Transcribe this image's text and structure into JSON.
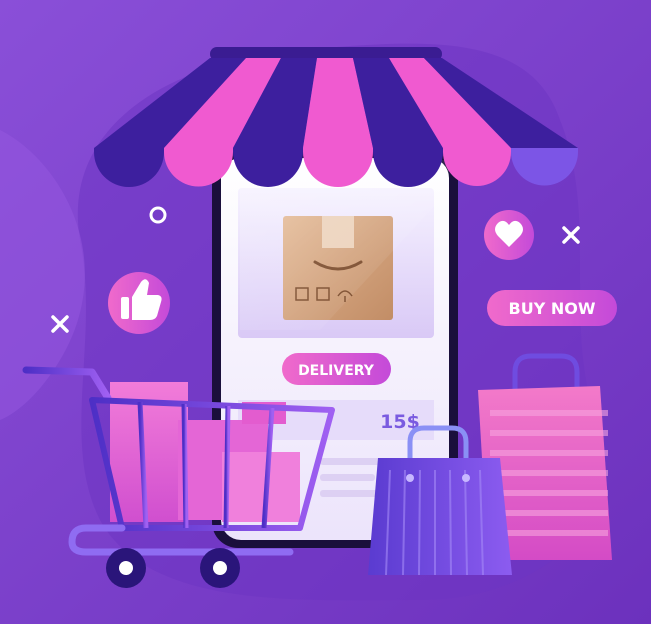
{
  "labels": {
    "delivery": "DELIVERY",
    "buy_now": "BUY NOW",
    "price": "15$"
  },
  "icons": {
    "like": "thumbs-up-icon",
    "favorite": "heart-icon",
    "package": "box-icon",
    "cart": "shopping-cart-icon"
  },
  "colors": {
    "background": "#7b3fc9",
    "accent_pink": "#f05ad0",
    "deep_purple": "#3d1f9e",
    "price": "#7a5be0"
  }
}
